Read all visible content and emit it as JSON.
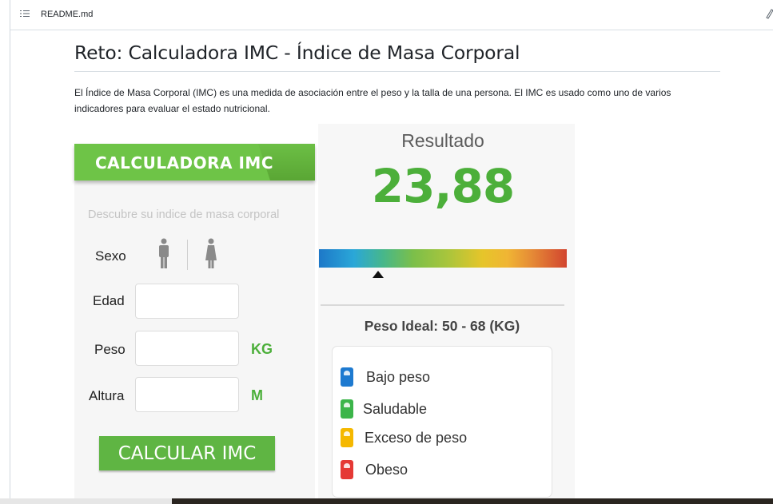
{
  "header": {
    "filename": "README.md"
  },
  "page": {
    "title": "Reto: Calculadora IMC - Índice de Masa Corporal",
    "description": "El Índice de Masa Corporal (IMC) es una medida de asociación entre el peso y la talla de una persona. El IMC es usado como uno de varios indicadores para evaluar el estado nutricional."
  },
  "calculator": {
    "header": "CALCULADORA IMC",
    "subtitle": "Descubre su indice de masa corporal",
    "sex_label": "Sexo",
    "age_label": "Edad",
    "weight_label": "Peso",
    "weight_unit": "KG",
    "height_label": "Altura",
    "height_unit": "M",
    "button": "CALCULAR IMC",
    "icons": [
      "male-icon",
      "female-icon"
    ]
  },
  "result": {
    "title": "Resultado",
    "value": "23,88",
    "ideal": "Peso Ideal: 50 - 68 (KG)",
    "scale_position": 0.24,
    "legend": [
      {
        "label": "Bajo peso",
        "color": "#1e7ad0",
        "icon": "scale-icon"
      },
      {
        "label": "Saludable",
        "color": "#3cb54a",
        "icon": "scale-icon"
      },
      {
        "label": "Exceso de peso",
        "color": "#f5b800",
        "icon": "scale-icon"
      },
      {
        "label": "Obeso",
        "color": "#e53935",
        "icon": "scale-icon"
      }
    ]
  },
  "colors": {
    "accent_green": "#4caf3a",
    "button_green": "#5fb543"
  }
}
